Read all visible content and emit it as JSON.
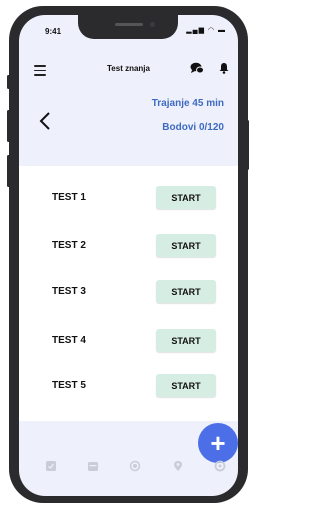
{
  "status_bar": {
    "time": "9:41",
    "icons": [
      "signal-icon",
      "wifi-icon",
      "battery-icon"
    ]
  },
  "header": {
    "title": "Test znanja",
    "icons": [
      "menu-icon",
      "chat-icon",
      "bell-icon"
    ]
  },
  "info": {
    "duration": "Trajanje 45 min",
    "points": "Bodovi 0/120"
  },
  "tests": [
    {
      "label": "TEST 1",
      "button": "START"
    },
    {
      "label": "TEST 2",
      "button": "START"
    },
    {
      "label": "TEST 3",
      "button": "START"
    },
    {
      "label": "TEST 4",
      "button": "START"
    },
    {
      "label": "TEST 5",
      "button": "START"
    }
  ],
  "fab": {
    "label": "+"
  },
  "bottom_nav": [
    "home-icon",
    "calendar-icon",
    "circle-icon",
    "location-icon",
    "settings-icon"
  ],
  "colors": {
    "accent": "#4c6fe8",
    "info_text": "#3f6ac2",
    "start_button": "#d6ede3",
    "header_bg": "#eef1fb"
  }
}
